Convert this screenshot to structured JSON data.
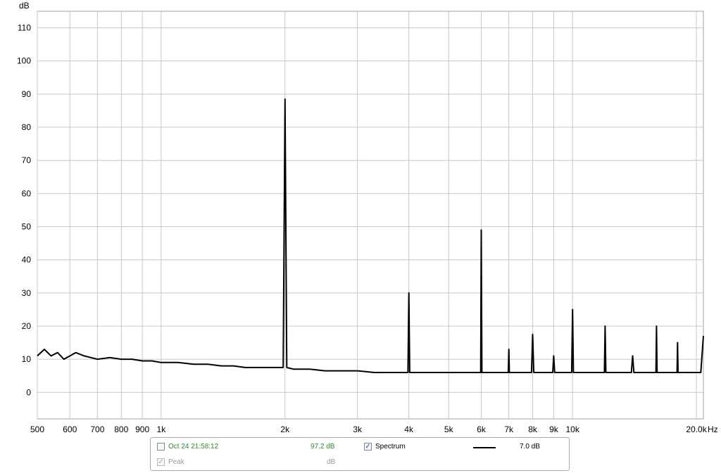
{
  "chart_data": {
    "type": "line",
    "ylabel": "dB",
    "xunit": "Hz",
    "xscale": "log",
    "xlim": [
      500,
      20800
    ],
    "ylim": [
      -8,
      115
    ],
    "grid": true,
    "yticks": [
      0,
      10,
      20,
      30,
      40,
      50,
      60,
      70,
      80,
      90,
      100,
      110
    ],
    "xticks": [
      {
        "value": 500,
        "label": "500"
      },
      {
        "value": 600,
        "label": "600"
      },
      {
        "value": 700,
        "label": "700"
      },
      {
        "value": 800,
        "label": "800"
      },
      {
        "value": 900,
        "label": "900"
      },
      {
        "value": 1000,
        "label": "1k"
      },
      {
        "value": 2000,
        "label": "2k"
      },
      {
        "value": 3000,
        "label": "3k"
      },
      {
        "value": 4000,
        "label": "4k"
      },
      {
        "value": 5000,
        "label": "5k"
      },
      {
        "value": 6000,
        "label": "6k"
      },
      {
        "value": 7000,
        "label": "7k"
      },
      {
        "value": 8000,
        "label": "8k"
      },
      {
        "value": 9000,
        "label": "9k"
      },
      {
        "value": 10000,
        "label": "10k"
      },
      {
        "value": 20000,
        "label": "20.0k"
      }
    ],
    "series": [
      {
        "color": "#000000",
        "x": [
          500,
          520,
          540,
          560,
          580,
          600,
          620,
          650,
          700,
          750,
          800,
          850,
          900,
          950,
          1000,
          1100,
          1200,
          1300,
          1400,
          1500,
          1600,
          1700,
          1800,
          1900,
          1980,
          2000,
          2020,
          2100,
          2300,
          2500,
          2700,
          3000,
          3300,
          3600,
          3900,
          3980,
          4000,
          4020,
          4200,
          4500,
          5000,
          5500,
          5900,
          5980,
          6000,
          6020,
          6300,
          6800,
          6980,
          7000,
          7020,
          7500,
          7950,
          8000,
          8050,
          8500,
          8950,
          9000,
          9050,
          9500,
          9950,
          10000,
          10050,
          11000,
          11950,
          12000,
          12050,
          13000,
          13900,
          14000,
          14100,
          15000,
          15950,
          16000,
          16050,
          17000,
          17950,
          18000,
          18050,
          19000,
          20000,
          20500,
          20800
        ],
        "y": [
          11,
          13,
          11,
          12,
          10,
          11,
          12,
          11,
          10,
          10.5,
          10,
          10,
          9.5,
          9.5,
          9,
          9,
          8.5,
          8.5,
          8,
          8,
          7.5,
          7.5,
          7.5,
          7.5,
          7.5,
          88.5,
          7.5,
          7,
          7,
          6.5,
          6.5,
          6.5,
          6,
          6,
          6,
          6,
          30,
          6,
          6,
          6,
          6,
          6,
          6,
          6,
          49,
          6,
          6,
          6,
          6,
          13,
          6,
          6,
          6,
          17.5,
          6,
          6,
          6,
          11,
          6,
          6,
          6,
          25,
          6,
          6,
          6,
          20,
          6,
          6,
          6,
          11,
          6,
          6,
          6,
          20,
          6,
          6,
          6,
          15,
          6,
          6,
          6,
          6,
          17
        ]
      }
    ]
  },
  "legend": {
    "entry1_label": "Oct 24 21:58:12",
    "entry1_value": "97.2 dB",
    "entry1_checked": false,
    "entry2_label": "Peak",
    "entry2_value": "dB",
    "entry2_checked": true,
    "series_label": "Spectrum",
    "series_checked": true,
    "series_value": "7.0 dB"
  },
  "colors": {
    "trace": "#000000",
    "grid": "#c8c8c8",
    "timestamp_text": "#2e8b2e",
    "disabled_text": "#9a9a9a"
  }
}
